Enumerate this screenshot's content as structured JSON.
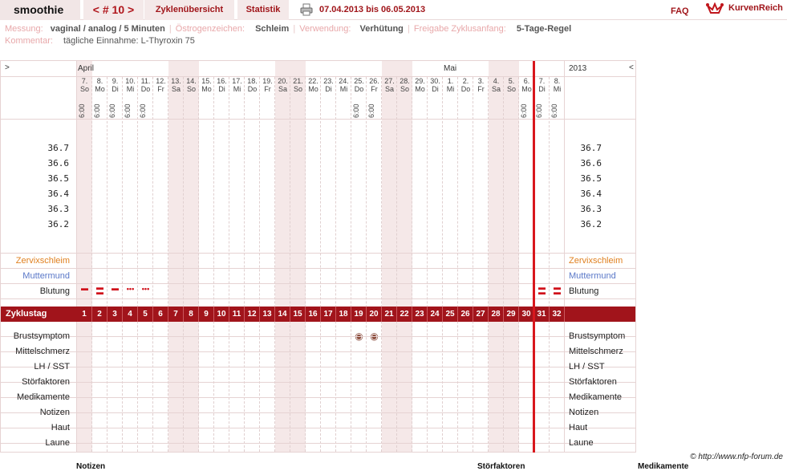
{
  "topbar": {
    "username": "smoothie",
    "cycle": "< # 10 >",
    "overview": "Zyklenübersicht",
    "stats": "Statistik",
    "range": "07.04.2013 bis 06.05.2013",
    "faq": "FAQ",
    "logo": "KurvenReich"
  },
  "info": {
    "messung_label": "Messung:",
    "messung_value": "vaginal / analog / 5 Minuten",
    "oestrogen_label": "Östrogenzeichen:",
    "oestrogen_value": "Schleim",
    "verwendung_label": "Verwendung:",
    "verwendung_value": "Verhütung",
    "freigabe_label": "Freigabe Zyklusanfang:",
    "freigabe_value": "5-Tage-Regel",
    "kommentar_label": "Kommentar:",
    "kommentar_value": "tägliche Einnahme: L-Thyroxin 75"
  },
  "chart": {
    "nav_left": ">",
    "nav_right": "<",
    "year": "2013",
    "months": [
      "April",
      "Mai"
    ],
    "cycle_label": "Zyklustag",
    "temps": [
      "36.7",
      "36.6",
      "36.5",
      "36.4",
      "36.3",
      "36.2"
    ],
    "rows_top": {
      "zervix": "Zervixschleim",
      "muttermund": "Muttermund",
      "blutung": "Blutung"
    },
    "rows_bottom": [
      "Brustsymptom",
      "Mittelschmerz",
      "LH / SST",
      "Störfaktoren",
      "Medikamente",
      "Notizen",
      "Haut",
      "Laune"
    ],
    "days": [
      {
        "d": "7.",
        "w": "So",
        "t": "6:00",
        "c": "1",
        "we": true,
        "b": "dash"
      },
      {
        "d": "8.",
        "w": "Mo",
        "t": "6:00",
        "c": "2",
        "we": false,
        "b": "dash2"
      },
      {
        "d": "9.",
        "w": "Di",
        "t": "6:00",
        "c": "3",
        "we": false,
        "b": "dash"
      },
      {
        "d": "10.",
        "w": "Mi",
        "t": "6:00",
        "c": "4",
        "we": false,
        "b": "dots"
      },
      {
        "d": "11.",
        "w": "Do",
        "t": "6:00",
        "c": "5",
        "we": false,
        "b": "dots"
      },
      {
        "d": "12.",
        "w": "Fr",
        "t": "",
        "c": "6",
        "we": false,
        "b": ""
      },
      {
        "d": "13.",
        "w": "Sa",
        "t": "",
        "c": "7",
        "we": true,
        "b": ""
      },
      {
        "d": "14.",
        "w": "So",
        "t": "",
        "c": "8",
        "we": true,
        "b": ""
      },
      {
        "d": "15.",
        "w": "Mo",
        "t": "",
        "c": "9",
        "we": false,
        "b": ""
      },
      {
        "d": "16.",
        "w": "Di",
        "t": "",
        "c": "10",
        "we": false,
        "b": ""
      },
      {
        "d": "17.",
        "w": "Mi",
        "t": "",
        "c": "11",
        "we": false,
        "b": ""
      },
      {
        "d": "18.",
        "w": "Do",
        "t": "",
        "c": "12",
        "we": false,
        "b": ""
      },
      {
        "d": "19.",
        "w": "Fr",
        "t": "",
        "c": "13",
        "we": false,
        "b": ""
      },
      {
        "d": "20.",
        "w": "Sa",
        "t": "",
        "c": "14",
        "we": true,
        "b": ""
      },
      {
        "d": "21.",
        "w": "So",
        "t": "",
        "c": "15",
        "we": true,
        "b": ""
      },
      {
        "d": "22.",
        "w": "Mo",
        "t": "",
        "c": "16",
        "we": false,
        "b": ""
      },
      {
        "d": "23.",
        "w": "Di",
        "t": "",
        "c": "17",
        "we": false,
        "b": ""
      },
      {
        "d": "24.",
        "w": "Mi",
        "t": "",
        "c": "18",
        "we": false,
        "b": ""
      },
      {
        "d": "25.",
        "w": "Do",
        "t": "6:00",
        "c": "19",
        "we": false,
        "b": "",
        "br": true
      },
      {
        "d": "26.",
        "w": "Fr",
        "t": "6:00",
        "c": "20",
        "we": false,
        "b": "",
        "br": true
      },
      {
        "d": "27.",
        "w": "Sa",
        "t": "",
        "c": "21",
        "we": true,
        "b": ""
      },
      {
        "d": "28.",
        "w": "So",
        "t": "",
        "c": "22",
        "we": true,
        "b": ""
      },
      {
        "d": "29.",
        "w": "Mo",
        "t": "",
        "c": "23",
        "we": false,
        "b": ""
      },
      {
        "d": "30.",
        "w": "Di",
        "t": "",
        "c": "24",
        "we": false,
        "b": ""
      },
      {
        "d": "1.",
        "w": "Mi",
        "t": "",
        "c": "25",
        "we": false,
        "b": ""
      },
      {
        "d": "2.",
        "w": "Do",
        "t": "",
        "c": "26",
        "we": false,
        "b": ""
      },
      {
        "d": "3.",
        "w": "Fr",
        "t": "",
        "c": "27",
        "we": false,
        "b": ""
      },
      {
        "d": "4.",
        "w": "Sa",
        "t": "",
        "c": "28",
        "we": true,
        "b": ""
      },
      {
        "d": "5.",
        "w": "So",
        "t": "",
        "c": "29",
        "we": true,
        "b": ""
      },
      {
        "d": "6.",
        "w": "Mo",
        "t": "6:00",
        "c": "30",
        "we": false,
        "b": ""
      },
      {
        "d": "7.",
        "w": "Di",
        "t": "6:00",
        "c": "31",
        "we": false,
        "b": "dash2"
      },
      {
        "d": "8.",
        "w": "Mi",
        "t": "6:00",
        "c": "32",
        "we": false,
        "b": "dash2"
      }
    ]
  },
  "footer": {
    "copyright": "© http://www.nfp-forum.de"
  },
  "bottom": {
    "notizen": "Notizen",
    "stoerfaktoren": "Störfaktoren",
    "medikamente": "Medikamente"
  }
}
